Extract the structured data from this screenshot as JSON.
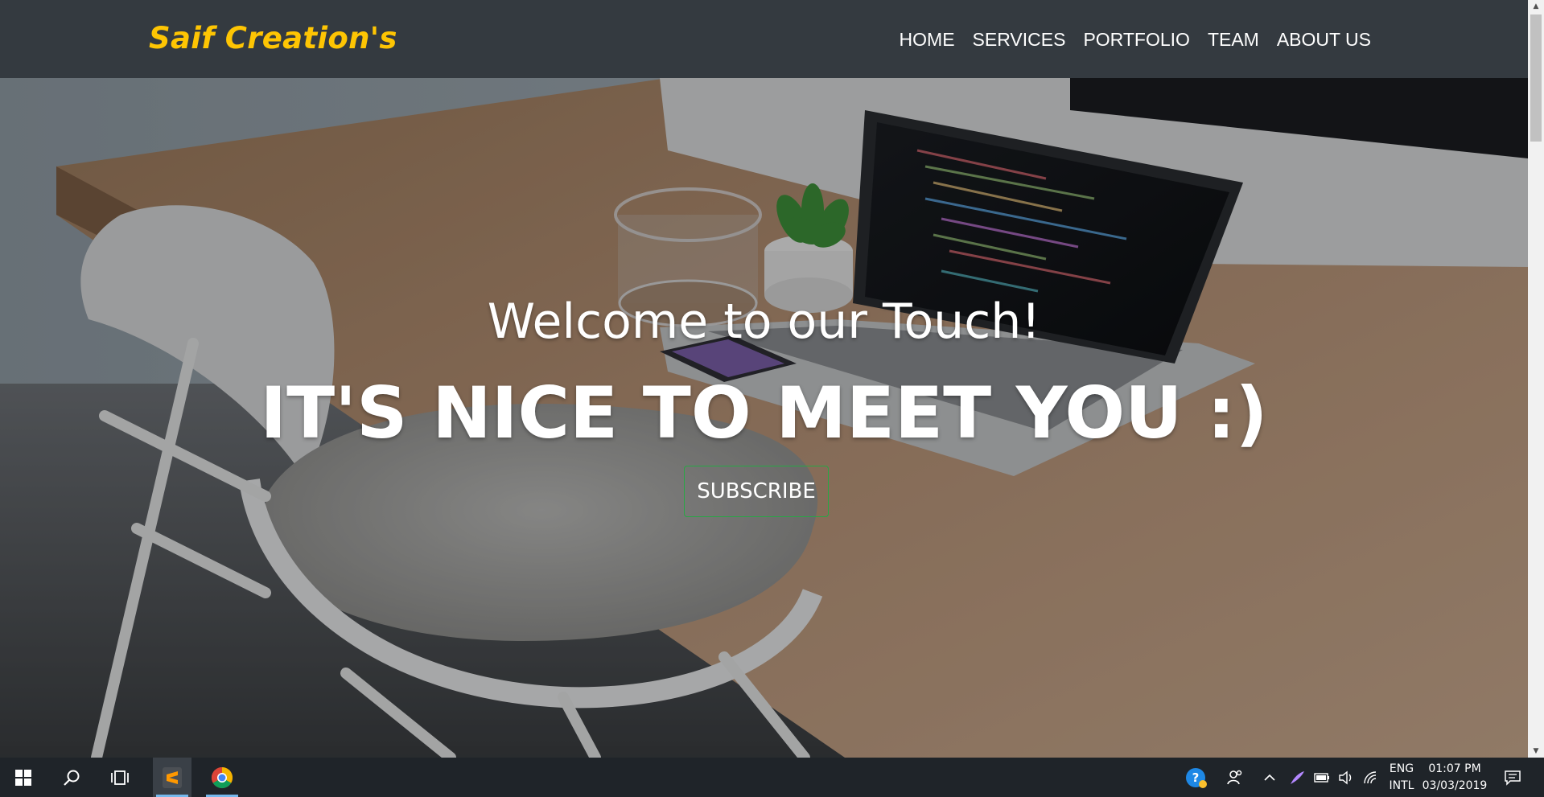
{
  "navbar": {
    "brand": "Saif Creation's",
    "links": [
      "HOME",
      "SERVICES",
      "PORTFOLIO",
      "TEAM",
      "ABOUT US"
    ]
  },
  "hero": {
    "lead": "Welcome to our Touch!",
    "heading": "IT'S NICE TO MEET YOU :)",
    "button": "SUBSCRIBE"
  },
  "taskbar": {
    "apps": [
      "windows-start-icon",
      "search-icon",
      "task-view-icon",
      "sublime-text-icon",
      "chrome-icon"
    ],
    "tray": {
      "language_top": "ENG",
      "language_bottom": "INTL",
      "time": "01:07 PM",
      "date": "03/03/2019"
    }
  },
  "colors": {
    "navbar_bg": "#343a40",
    "brand": "#fec503",
    "button_border": "#28a745",
    "taskbar_bg": "#1f2429"
  }
}
